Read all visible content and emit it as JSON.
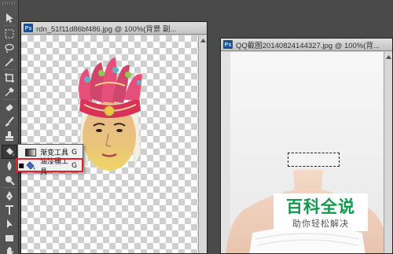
{
  "left_document": {
    "title": "rdn_51f11d86bf486.jpg @ 100%(背景 副..."
  },
  "right_document": {
    "title": "QQ截图20140824144327.jpg @ 100%(背..."
  },
  "app_badge": "Ps",
  "flyout_menu": {
    "items": [
      {
        "label": "渐变工具",
        "shortcut": "G",
        "selected": false,
        "icon": "gradient-icon"
      },
      {
        "label": "油漆桶工具",
        "shortcut": "G",
        "selected": true,
        "icon": "paint-bucket-icon"
      }
    ]
  },
  "watermark": {
    "title": "百科全说",
    "subtitle": "助你轻松解决"
  },
  "toolbox": {
    "tools": [
      "move-tool-icon",
      "marquee-tool-icon",
      "lasso-tool-icon",
      "magic-wand-icon",
      "crop-tool-icon",
      "eyedropper-icon",
      "healing-brush-icon",
      "brush-tool-icon",
      "clone-stamp-icon",
      "history-brush-icon",
      "eraser-tool-icon",
      "paint-bucket-tool-icon",
      "blur-tool-icon",
      "dodge-tool-icon",
      "pen-tool-icon",
      "type-tool-icon",
      "path-selection-icon",
      "shape-tool-icon",
      "hand-tool-icon",
      "zoom-tool-icon"
    ]
  },
  "colors": {
    "highlight_border": "#d8232a",
    "watermark_green": "#0e9a4c"
  }
}
